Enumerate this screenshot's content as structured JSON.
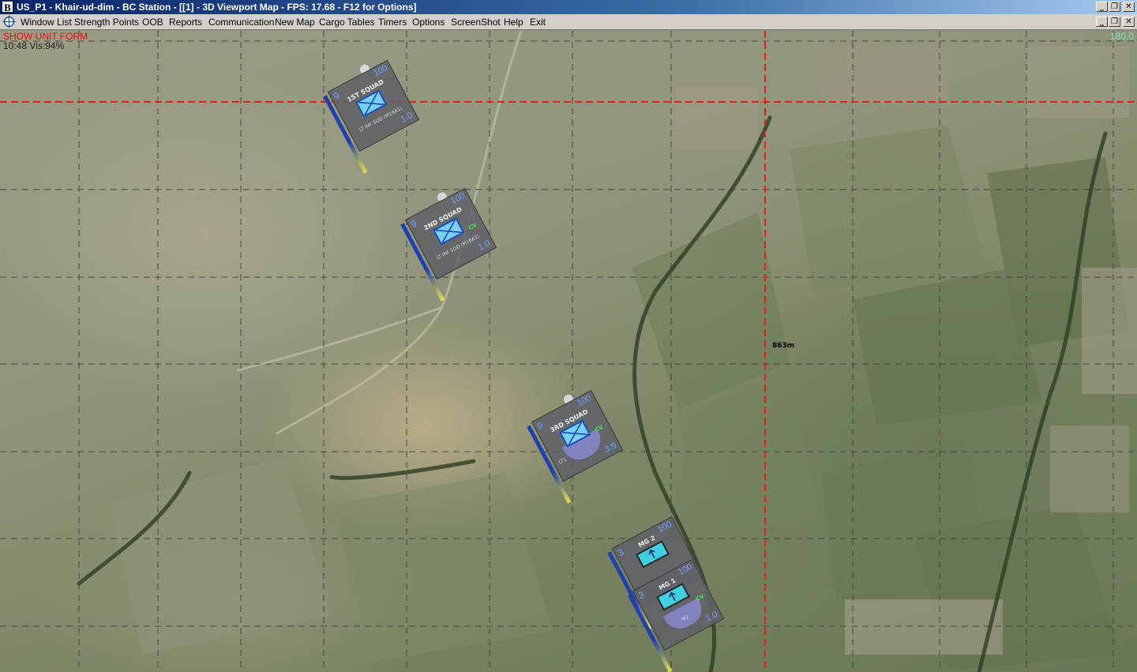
{
  "window": {
    "app_badge": "B",
    "title": "US_P1 - Khair-ud-dim - BC Station - [[1] - 3D Viewport Map - FPS: 17.68 - F12 for Options]",
    "controls": {
      "minimize": "_",
      "restore": "❐",
      "close": "✕"
    }
  },
  "menu": {
    "icon": "crosshair-compass-icon",
    "items": [
      "Window List",
      "Strength Points",
      "OOB",
      "Reports",
      "Communication",
      "New Map",
      "Cargo Tables",
      "Timers",
      "Options",
      "ScreenShot",
      "Help",
      "Exit"
    ]
  },
  "hud": {
    "show_unit_form": "SHOW UNIT FORM",
    "time_vis": "10:48 Vis:94%",
    "bearing": "180.0",
    "distance_label": "863m"
  },
  "colors": {
    "title_bar": "#0a246a",
    "hud_alert": "#e01010",
    "crosshair": "#e02020",
    "grid": "#404040",
    "unit_blue": "#6fa0ff",
    "symbol_fill": "#7ad0f0"
  },
  "units": [
    {
      "id": "1st-squad",
      "num": "9",
      "strength": "100",
      "name": "1ST SQUAD",
      "sub": "LT INF SQD (M16A1)",
      "value": "1.0",
      "badge": ""
    },
    {
      "id": "2nd-squad",
      "num": "9",
      "strength": "100",
      "name": "2ND SQUAD",
      "sub": "LT INF SQD (M16A1)",
      "value": "1.0",
      "badge": "CV"
    },
    {
      "id": "3rd-squad",
      "num": "9",
      "strength": "100",
      "name": "3RD SQUAD",
      "sub": "LT1",
      "value": "3.9",
      "badge": "CV"
    },
    {
      "id": "mg2",
      "num": "3",
      "strength": "100",
      "name": "MG 2",
      "sub": "",
      "value": "",
      "badge": ""
    },
    {
      "id": "mg1",
      "num": "3",
      "strength": "100",
      "name": "MG 1",
      "sub": "M2",
      "value": "1.0",
      "badge": "CV"
    }
  ]
}
